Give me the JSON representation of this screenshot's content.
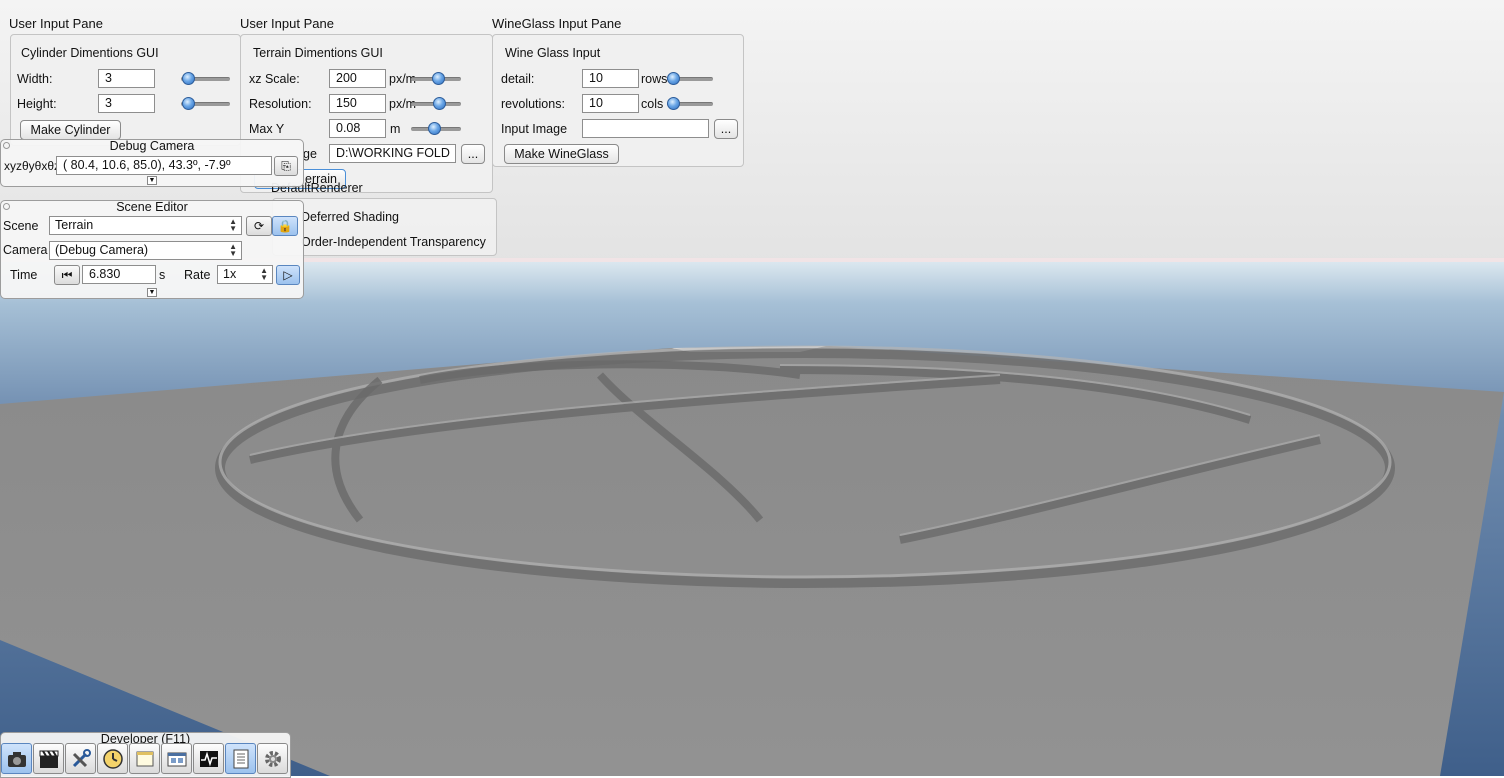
{
  "colors": {
    "sky_top": "#ececec",
    "horizon_band": "#f3e7e8",
    "water": "#6b87a8",
    "terrain": "#8c8c8c",
    "accent": "#4a8fd8"
  },
  "cylinder_pane": {
    "pane_title": "User Input Pane",
    "group_title": "Cylinder Dimentions GUI",
    "width_label": "Width:",
    "width_value": "3",
    "height_label": "Height:",
    "height_value": "3",
    "make_button": "Make Cylinder",
    "width_slider": 0.07,
    "height_slider": 0.07
  },
  "terrain_pane": {
    "pane_title": "User Input Pane",
    "group_title": "Terrain Dimentions GUI",
    "xz_label": "xz Scale:",
    "xz_value": "200",
    "xz_unit": "px/m",
    "res_label": "Resolution:",
    "res_value": "150",
    "res_unit": "px/m",
    "maxy_label": "Max Y",
    "maxy_value": "0.08",
    "maxy_unit": "m",
    "image_label_partial": "ge",
    "image_value": "D:\\WORKING FOLD",
    "browse": "...",
    "make_button_partial": "errain",
    "renderer": "DefaultRenderer",
    "deferred": "Deferred Shading",
    "oit": "Order-Independent Transparency"
  },
  "wineglass_pane": {
    "pane_title": "WineGlass Input Pane",
    "group_title": "Wine Glass Input",
    "detail_label": "detail:",
    "detail_value": "10",
    "detail_unit": "rows",
    "rev_label": "revolutions:",
    "rev_value": "10",
    "rev_unit": "cols",
    "image_label": "Input Image",
    "image_value": "",
    "browse": "...",
    "make_button": "Make WineGlass"
  },
  "debug_camera": {
    "title": "Debug Camera",
    "coord_label": "xyzθyθxθz",
    "value": "( 80.4,  10.6,  85.0),  43.3º,  -7.9º"
  },
  "scene_editor": {
    "title": "Scene Editor",
    "scene_label": "Scene",
    "scene_value": "Terrain",
    "camera_label": "Camera",
    "camera_value": "(Debug Camera)",
    "time_label": "Time",
    "time_value": "6.830",
    "time_unit": "s",
    "rate_label": "Rate",
    "rate_value": "1x"
  },
  "developer": {
    "title": "Developer (F11)",
    "tools": [
      "camera-icon",
      "clapperboard-icon",
      "tools-icon",
      "clock-icon",
      "window-icon",
      "windows-icon",
      "profiler-icon",
      "log-icon",
      "gear-icon"
    ]
  }
}
